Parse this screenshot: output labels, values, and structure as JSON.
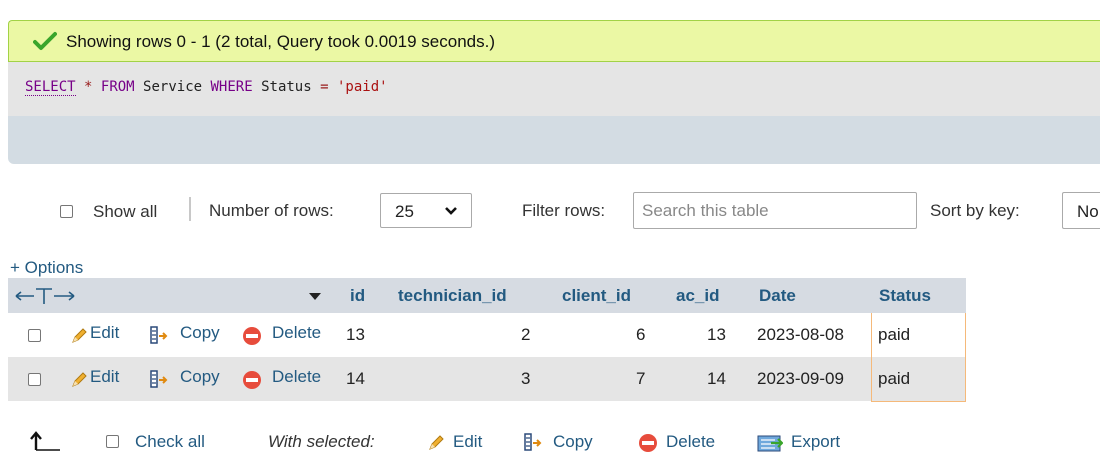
{
  "result": {
    "message": "Showing rows 0 - 1 (2 total, Query took 0.0019 seconds.)",
    "sql": {
      "select": "SELECT",
      "star": "*",
      "from": "FROM",
      "table": "Service",
      "where": "WHERE",
      "column": "Status",
      "eq": "=",
      "value": "'paid'"
    }
  },
  "nav": {
    "show_all_label": "Show all",
    "rows_label": "Number of rows:",
    "rows_value": "25",
    "filter_label": "Filter rows:",
    "filter_placeholder": "Search this table",
    "sort_label": "Sort by key:",
    "sort_value": "No"
  },
  "options_link": "+ Options",
  "table": {
    "columns": [
      "id",
      "technician_id",
      "client_id",
      "ac_id",
      "Date",
      "Status"
    ],
    "action_labels": {
      "edit": "Edit",
      "copy": "Copy",
      "delete": "Delete"
    },
    "rows": [
      {
        "id": "13",
        "technician_id": "2",
        "client_id": "6",
        "ac_id": "13",
        "date": "2023-08-08",
        "status": "paid"
      },
      {
        "id": "14",
        "technician_id": "3",
        "client_id": "7",
        "ac_id": "14",
        "date": "2023-09-09",
        "status": "paid"
      }
    ]
  },
  "bottom": {
    "check_all": "Check all",
    "with_selected": "With selected:",
    "edit": "Edit",
    "copy": "Copy",
    "delete": "Delete",
    "export": "Export"
  },
  "colors": {
    "success_bg": "#ebf8a4",
    "link": "#235a81",
    "header_bg": "#d6dbe2",
    "row_alt_bg": "#e5e5e5",
    "delete_red": "#e74c3c"
  }
}
